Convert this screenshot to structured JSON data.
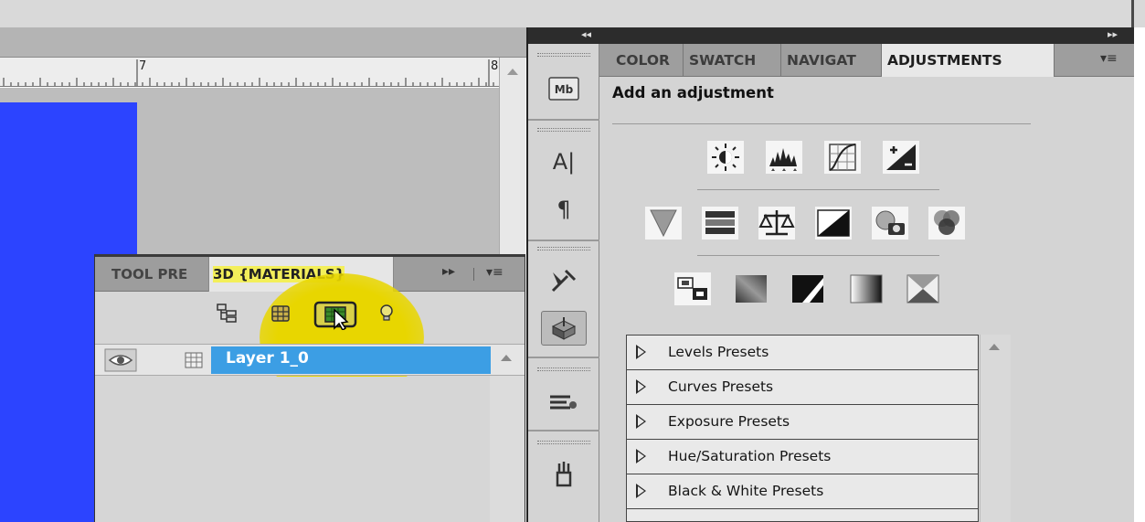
{
  "colors": {
    "canvas_blue": "#2c44ff",
    "highlight_yellow": "#e8d600",
    "selected_layer": "#3c9ee4"
  },
  "ruler": {
    "marks": [
      "7",
      "8"
    ]
  },
  "panel_3d": {
    "tabs": [
      "TOOL PRE",
      "3D {MATERIALS}"
    ],
    "forward_glyph": "▸▸",
    "menu_glyph": "▾≡",
    "toolbar_icons": [
      "scene-tree-icon",
      "mesh-icon",
      "materials-icon",
      "light-bulb-icon"
    ],
    "layer": {
      "name": "Layer 1_0"
    }
  },
  "dock": {
    "collapse_glyph": "◂◂",
    "buttons": [
      {
        "icon": "mini-bridge-icon",
        "label": "Mb"
      },
      {
        "icon": "character-icon",
        "label": "A|"
      },
      {
        "icon": "paragraph-icon",
        "label": "¶"
      },
      {
        "icon": "tools-icon"
      },
      {
        "icon": "3d-icon"
      },
      {
        "icon": "brush-presets-icon"
      },
      {
        "icon": "clone-source-icon"
      }
    ]
  },
  "adjustments_panel": {
    "forward_glyph": "▸▸",
    "menu_glyph": "▾≡",
    "tabs": [
      "COLOR",
      "SWATCH",
      "NAVIGAT",
      "ADJUSTMENTS"
    ],
    "header": "Add an adjustment",
    "icon_rows": [
      [
        "brightness-contrast-icon",
        "levels-icon",
        "curves-icon",
        "exposure-icon"
      ],
      [
        "vibrance-icon",
        "hue-saturation-icon",
        "color-balance-icon",
        "black-white-icon",
        "photo-filter-icon",
        "channel-mixer-icon"
      ],
      [
        "invert-icon",
        "posterize-icon",
        "threshold-icon",
        "gradient-map-icon",
        "selective-color-icon"
      ]
    ],
    "presets": [
      "Levels Presets",
      "Curves Presets",
      "Exposure Presets",
      "Hue/Saturation Presets",
      "Black & White Presets"
    ]
  }
}
